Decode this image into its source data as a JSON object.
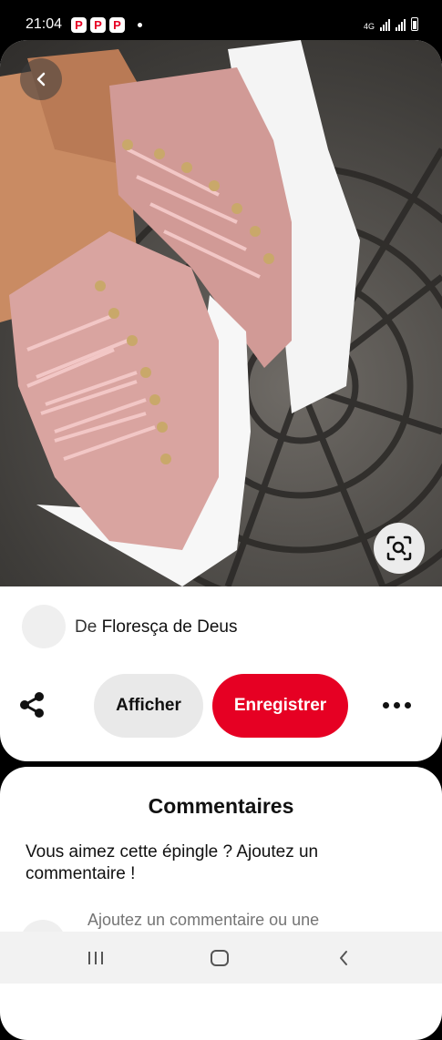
{
  "status_bar": {
    "time": "21:04",
    "app_icons": [
      "P",
      "P",
      "P"
    ],
    "network_label": "4G"
  },
  "pin": {
    "image_icon": "pink-sneaker-photo",
    "author_prefix": "De",
    "author_name": "Floresça de Deus"
  },
  "actions": {
    "view_label": "Afficher",
    "save_label": "Enregistrer"
  },
  "comments": {
    "title": "Commentaires",
    "prompt": "Vous aimez cette épingle ? Ajoutez un commentaire !",
    "input_placeholder": "Ajoutez un commentaire ou une"
  },
  "colors": {
    "brand_red": "#e60023",
    "neutral_button": "#e9e9e9",
    "placeholder_gray": "#767676"
  }
}
